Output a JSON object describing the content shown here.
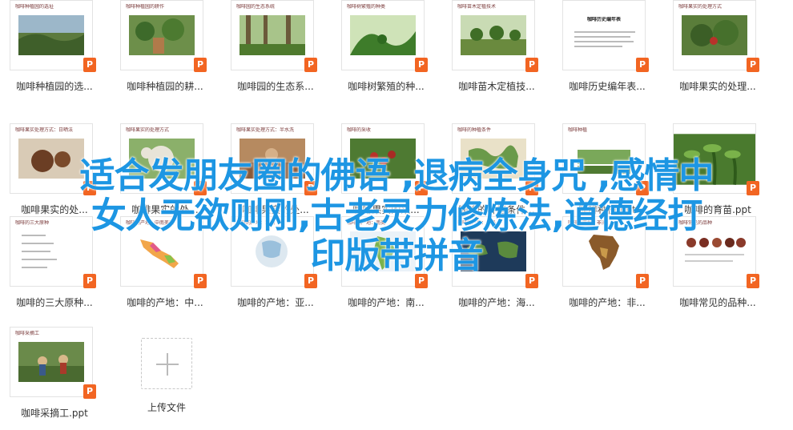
{
  "files": [
    {
      "thumb_title": "咖啡种植园的选址",
      "caption": "咖啡种植园的选...",
      "badge": "P"
    },
    {
      "thumb_title": "咖啡种植园的耕作",
      "caption": "咖啡种植园的耕...",
      "badge": "P"
    },
    {
      "thumb_title": "咖啡园的生态系统",
      "caption": "咖啡园的生态系...",
      "badge": "P"
    },
    {
      "thumb_title": "咖啡树繁殖的种类",
      "caption": "咖啡树繁殖的种...",
      "badge": "P"
    },
    {
      "thumb_title": "咖啡苗木定植技术",
      "caption": "咖啡苗木定植技...",
      "badge": "P"
    },
    {
      "thumb_title": "咖啡历史编年表",
      "caption": "咖啡历史编年表...",
      "badge": "P"
    },
    {
      "thumb_title": "咖啡果实的处理方式",
      "caption": "咖啡果实的处理...",
      "badge": "P"
    },
    {
      "thumb_title": "咖啡果实处理方式：日晒法",
      "caption": "咖啡果实的处...",
      "badge": "P"
    },
    {
      "thumb_title": "咖啡果实的处理方式",
      "caption": "咖啡果实的处...",
      "badge": "P"
    },
    {
      "thumb_title": "咖啡果实处理方式：半水洗",
      "caption": "咖啡果实的处...",
      "badge": "P"
    },
    {
      "thumb_title": "咖啡的采收",
      "caption": "咖啡果实的采...",
      "badge": "P"
    },
    {
      "thumb_title": "咖啡的种植条件",
      "caption": "咖啡的种植条件...",
      "badge": "P"
    },
    {
      "thumb_title": "咖啡种植",
      "caption": "咖啡种植.ppt",
      "badge": "P"
    },
    {
      "thumb_title": "咖啡的育苗",
      "caption": "咖啡的育苗.ppt",
      "badge": "P"
    },
    {
      "thumb_title": "咖啡的三大原种",
      "caption": "咖啡的三大原种...",
      "badge": "P"
    },
    {
      "thumb_title": "咖啡的产地：中南美洲",
      "caption": "咖啡的产地：中...",
      "badge": "P"
    },
    {
      "thumb_title": "咖啡的产地：亚洲",
      "caption": "咖啡的产地：亚...",
      "badge": "P"
    },
    {
      "thumb_title": "咖啡的产地：南美",
      "caption": "咖啡的产地：南...",
      "badge": "P"
    },
    {
      "thumb_title": "咖啡的产地：海岛",
      "caption": "咖啡的产地：海...",
      "badge": "P"
    },
    {
      "thumb_title": "咖啡的产地：非洲",
      "caption": "咖啡的产地：非...",
      "badge": "P"
    },
    {
      "thumb_title": "咖啡常见的品种",
      "caption": "咖啡常见的品种...",
      "badge": "P"
    },
    {
      "thumb_title": "咖啡采摘工",
      "caption": "咖啡采摘工.ppt",
      "badge": "P"
    }
  ],
  "upload": {
    "label": "上传文件"
  },
  "overlay": {
    "line1": "适合发朋友圈的佛语 ,退病全身咒 ,感情中",
    "line2": "女人无欲则刚,古老灵力修炼法,道德经打",
    "line3": "印版带拼音"
  },
  "colors": {
    "badge": "#f26522",
    "overlay_text": "#1d96e3"
  }
}
